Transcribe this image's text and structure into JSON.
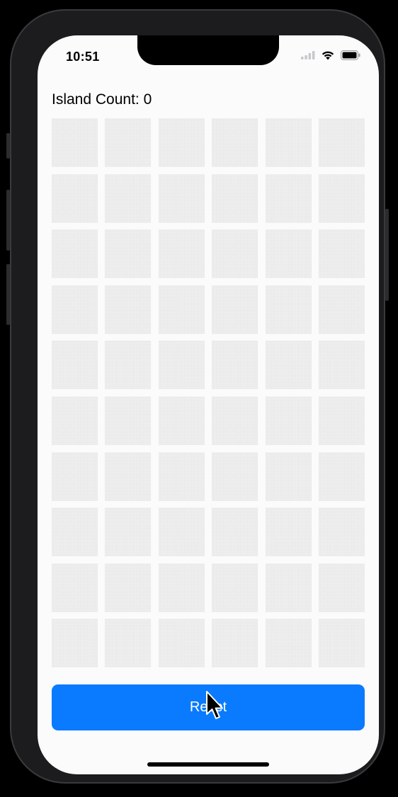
{
  "status_bar": {
    "time": "10:51",
    "icons": [
      "cellular-icon",
      "wifi-icon",
      "battery-icon"
    ]
  },
  "island_count": {
    "label": "Island Count: 0"
  },
  "grid": {
    "rows": 10,
    "columns": 6,
    "cells_state": "water",
    "cell_color": "#ececec"
  },
  "reset_button": {
    "label": "Reset",
    "color": "#0a7aff"
  }
}
